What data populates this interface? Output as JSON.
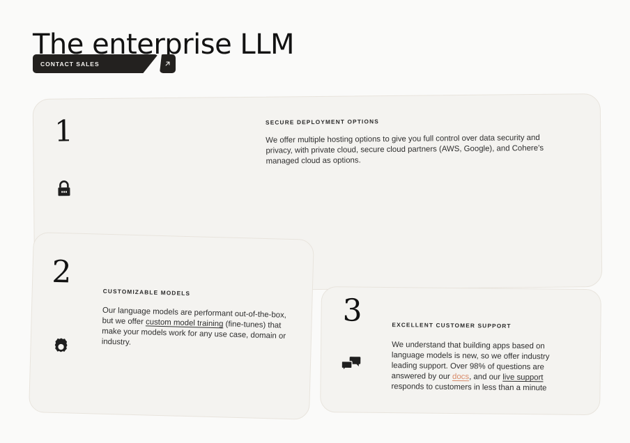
{
  "hero": {
    "title": "The enterprise LLM",
    "cta_label": "CONTACT SALES",
    "cta_icon": "arrow-up-right-icon"
  },
  "colors": {
    "page_background": "#fafaf9",
    "card_background": "#f4f3f0",
    "card_border": "#e8e4dd",
    "button_background": "#23211f",
    "button_text": "#f5f3f0",
    "heading_text": "#121212",
    "body_text": "#2e2e2e",
    "accent_link": "#d98b6a"
  },
  "cards": [
    {
      "number": "1",
      "icon": "padlock-icon",
      "eyebrow": "SECURE DEPLOYMENT OPTIONS",
      "body_parts": [
        {
          "type": "text",
          "value": "We offer multiple hosting options to give you full control over data security and privacy, with private cloud, secure cloud partners (AWS, Google), and Cohere’s managed cloud as options."
        }
      ]
    },
    {
      "number": "2",
      "icon": "gear-icon",
      "eyebrow": "CUSTOMIZABLE MODELS",
      "body_parts": [
        {
          "type": "text",
          "value": "Our language models are performant out-of-the-box, but we offer "
        },
        {
          "type": "link",
          "value": "custom model training",
          "accent": false
        },
        {
          "type": "text",
          "value": " (fine-tunes) that make your models work for any use case, domain or industry."
        }
      ]
    },
    {
      "number": "3",
      "icon": "chat-bubbles-icon",
      "eyebrow": "EXCELLENT CUSTOMER SUPPORT",
      "body_parts": [
        {
          "type": "text",
          "value": "We understand that building apps based on language models is new, so we offer industry leading support. Over 98% of questions are answered by our "
        },
        {
          "type": "link",
          "value": "docs",
          "accent": true
        },
        {
          "type": "text",
          "value": ", and our "
        },
        {
          "type": "link",
          "value": "live support",
          "accent": false
        },
        {
          "type": "text",
          "value": " responds to customers in less than a minute"
        }
      ]
    }
  ]
}
